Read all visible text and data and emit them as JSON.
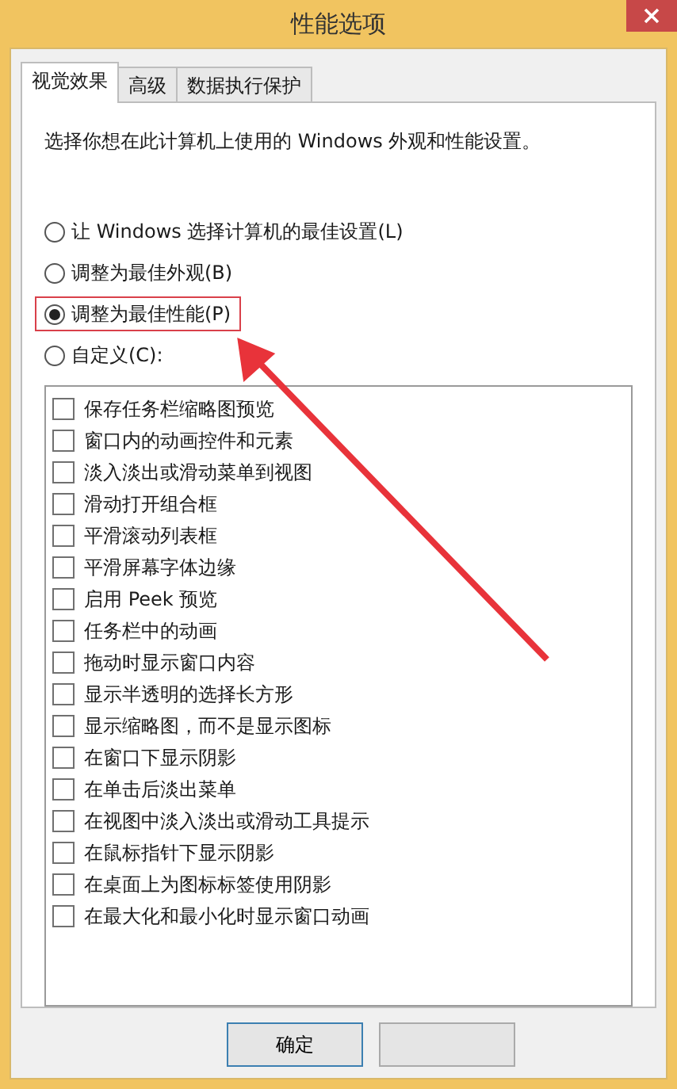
{
  "window": {
    "title": "性能选项"
  },
  "tabs": [
    {
      "label": "视觉效果",
      "selected": true
    },
    {
      "label": "高级",
      "selected": false
    },
    {
      "label": "数据执行保护",
      "selected": false
    }
  ],
  "description": "选择你想在此计算机上使用的 Windows 外观和性能设置。",
  "options": [
    {
      "label": "让 Windows 选择计算机的最佳设置(L)",
      "selected": false,
      "highlighted": false
    },
    {
      "label": "调整为最佳外观(B)",
      "selected": false,
      "highlighted": false
    },
    {
      "label": "调整为最佳性能(P)",
      "selected": true,
      "highlighted": true
    },
    {
      "label": "自定义(C):",
      "selected": false,
      "highlighted": false
    }
  ],
  "effects": [
    {
      "label": "保存任务栏缩略图预览",
      "checked": false
    },
    {
      "label": "窗口内的动画控件和元素",
      "checked": false
    },
    {
      "label": "淡入淡出或滑动菜单到视图",
      "checked": false
    },
    {
      "label": "滑动打开组合框",
      "checked": false
    },
    {
      "label": "平滑滚动列表框",
      "checked": false
    },
    {
      "label": "平滑屏幕字体边缘",
      "checked": false
    },
    {
      "label": "启用 Peek 预览",
      "checked": false
    },
    {
      "label": "任务栏中的动画",
      "checked": false
    },
    {
      "label": "拖动时显示窗口内容",
      "checked": false
    },
    {
      "label": "显示半透明的选择长方形",
      "checked": false
    },
    {
      "label": "显示缩略图，而不是显示图标",
      "checked": false
    },
    {
      "label": "在窗口下显示阴影",
      "checked": false
    },
    {
      "label": "在单击后淡出菜单",
      "checked": false
    },
    {
      "label": "在视图中淡入淡出或滑动工具提示",
      "checked": false
    },
    {
      "label": "在鼠标指针下显示阴影",
      "checked": false
    },
    {
      "label": "在桌面上为图标标签使用阴影",
      "checked": false
    },
    {
      "label": "在最大化和最小化时显示窗口动画",
      "checked": false
    }
  ],
  "buttons": [
    {
      "kind": "default",
      "label": "确定"
    },
    {
      "kind": "normal"
    }
  ]
}
